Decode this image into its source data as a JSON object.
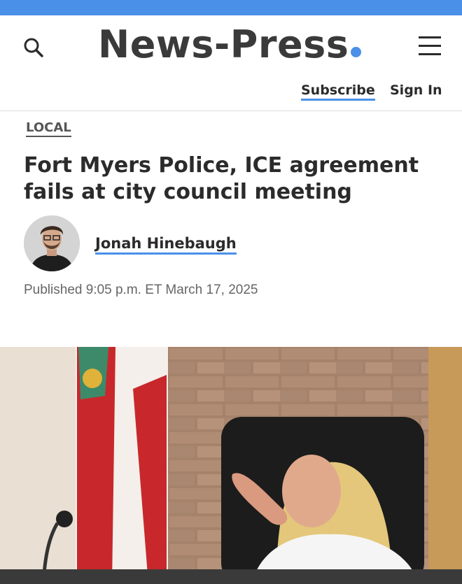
{
  "header": {
    "logo_text": "News-Press",
    "subscribe_label": "Subscribe",
    "signin_label": "Sign In",
    "search_icon": "search-icon",
    "menu_icon": "hamburger-menu-icon"
  },
  "article": {
    "section": "LOCAL",
    "headline": "Fort Myers Police, ICE agreement fails at city council meeting",
    "author": "Jonah Hinebaugh",
    "published": "Published 9:05 p.m. ET March 17, 2025"
  },
  "colors": {
    "accent": "#4a90e8",
    "text": "#2b2b2b",
    "muted": "#666666"
  }
}
